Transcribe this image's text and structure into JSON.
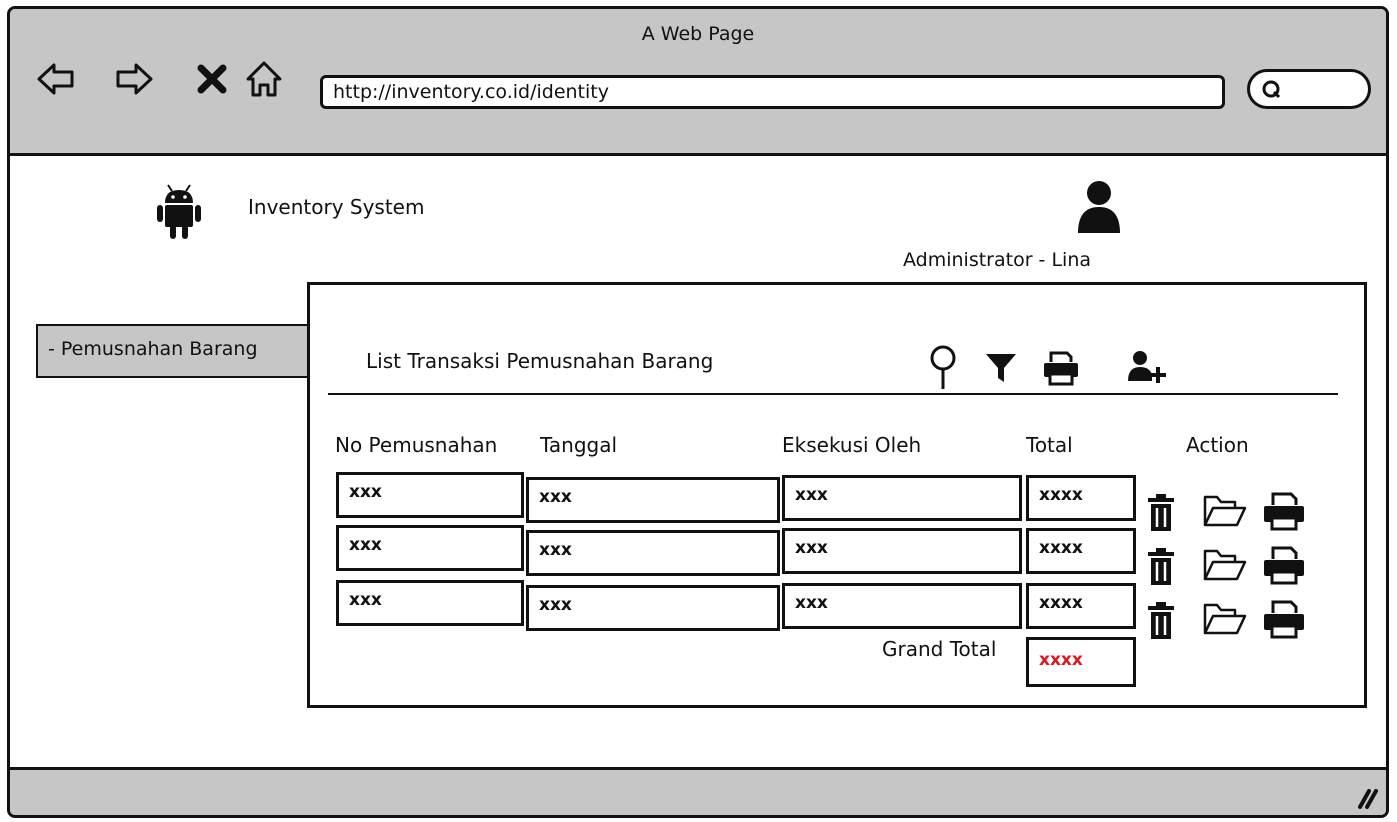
{
  "window": {
    "title": "A Web Page"
  },
  "browser": {
    "url": "http://inventory.co.id/identity"
  },
  "app": {
    "brand": "Inventory System",
    "user": "Administrator - Lina"
  },
  "sidebar": {
    "items": [
      {
        "label": "- Pemusnahan Barang"
      }
    ]
  },
  "panel": {
    "title": "List Transaksi Pemusnahan Barang",
    "toolbar_icons": [
      "search-icon",
      "filter-icon",
      "print-icon",
      "add-user-icon"
    ]
  },
  "table": {
    "headers": [
      "No Pemusnahan",
      "Tanggal",
      "Eksekusi Oleh",
      "Total",
      "Action"
    ],
    "rows": [
      [
        "xxx",
        "xxx",
        "xxx",
        "xxxx"
      ],
      [
        "xxx",
        "xxx",
        "xxx",
        "xxxx"
      ],
      [
        "xxx",
        "xxx",
        "xxx",
        "xxxx"
      ]
    ],
    "row_actions": [
      "trash-icon",
      "folder-open-icon",
      "print-icon"
    ],
    "grand_total_label": "Grand Total",
    "grand_total_value": "xxxx",
    "grand_total_color": "#e0141e"
  },
  "colors": {
    "chrome": "#c6c6c6",
    "border": "#111111"
  }
}
